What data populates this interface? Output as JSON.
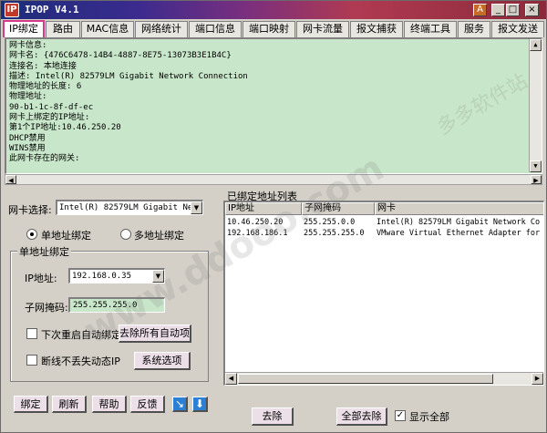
{
  "window": {
    "title": "IPOP V4.1",
    "alt_button": "A",
    "min_button": "_",
    "max_button": "□",
    "close_button": "×"
  },
  "tabs": [
    "IP绑定",
    "路由",
    "MAC信息",
    "网络统计",
    "端口信息",
    "端口映射",
    "网卡流量",
    "报文捕获",
    "终端工具",
    "服务",
    "报文发送"
  ],
  "info_lines": [
    "网卡信息:",
    "网卡名: {476C6478-14B4-4887-8E75-13073B3E1B4C}",
    "连接名: 本地连接",
    "描述: Intel(R) 82579LM Gigabit Network Connection",
    "物理地址的长度: 6",
    "物理地址:",
    "90-b1-1c-8f-df-ec",
    "网卡上绑定的IP地址:",
    "第1个IP地址:10.46.250.20",
    "DHCP禁用",
    "WINS禁用",
    "此网卡存在的网关:"
  ],
  "left_panel": {
    "nic_label": "网卡选择:",
    "nic_value": "Intel(R) 82579LM Gigabit Net",
    "radio_single": "单地址绑定",
    "radio_multi": "多地址绑定",
    "group_title": "单地址绑定",
    "ip_label": "IP地址:",
    "ip_value": "192.168.0.35",
    "mask_label": "子网掩码:",
    "mask_value": "255.255.255.0",
    "reboot_check": "下次重启自动绑定",
    "reboot_button": "去除所有自动项",
    "keep_check": "断线不丢失动态IP",
    "system_button": "系统选项",
    "bind_button": "绑定",
    "refresh_button": "刷新",
    "help_button": "帮助",
    "feedback_button": "反馈",
    "arrow_button": "↘",
    "down_button": "⬇"
  },
  "right_panel": {
    "list_title": "已绑定地址列表",
    "columns": [
      "IP地址",
      "子网掩码",
      "网卡"
    ],
    "rows": [
      [
        "10.46.250.20",
        "255.255.0.0",
        "Intel(R) 82579LM Gigabit Network Co"
      ],
      [
        "192.168.186.1",
        "255.255.255.0",
        "VMware Virtual Ethernet Adapter for"
      ]
    ],
    "remove_button": "去除",
    "remove_all_button": "全部去除",
    "show_all_check": "显示全部"
  },
  "watermark": {
    "main": "www.ddooo.com",
    "side": "多多软件站"
  }
}
